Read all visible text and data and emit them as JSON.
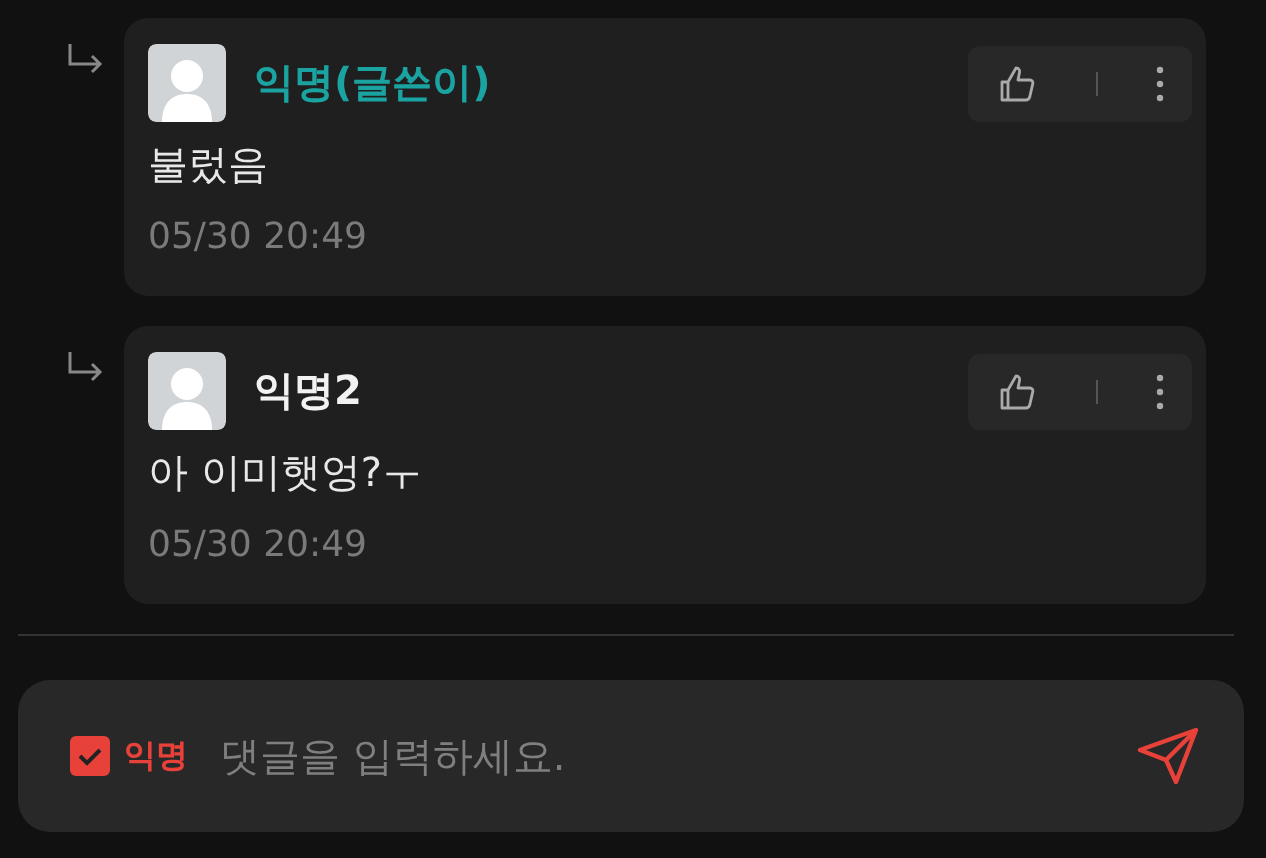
{
  "comments": [
    {
      "author": "익명(글쓴이)",
      "is_author": true,
      "text": "불렀음",
      "time": "05/30 20:49"
    },
    {
      "author": "익명2",
      "is_author": false,
      "text": "아 이미햇엉?ㅜ",
      "time": "05/30 20:49"
    }
  ],
  "composer": {
    "anonymous_label": "익명",
    "anonymous_checked": true,
    "placeholder": "댓글을 입력하세요."
  }
}
